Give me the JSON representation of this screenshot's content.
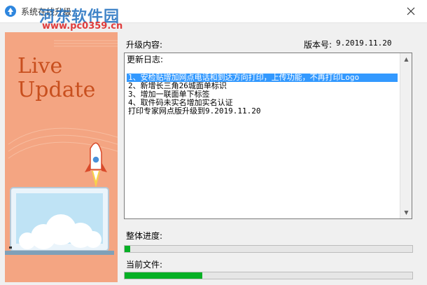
{
  "window": {
    "title": "系统在线升级",
    "watermark_site": "河东软件园",
    "watermark_url": "www.pc0359.cn"
  },
  "side_banner": {
    "line1": "Live",
    "line2": "Update",
    "bg_color": "#f4a582",
    "text_color": "#c84f1e"
  },
  "upgrade": {
    "content_label": "升级内容:",
    "version_label": "版本号:",
    "version_value": "9.2019.11.20"
  },
  "log": {
    "title": "更新日志:",
    "lines": [
      "1、安检贴增加网点电话和到达方向打印，上传功能，不再打印Logo",
      "2、新增长三角26城面单标识",
      "3、增加一联面单下标签",
      "4、取件码未实名增加实名认证",
      "打印专家网点版升级到9.2019.11.20"
    ],
    "selected_index": 0
  },
  "progress": {
    "overall_label": "整体进度:",
    "overall_fraction": 0.02,
    "current_label": "当前文件:",
    "current_fraction": 0.27
  },
  "colors": {
    "progress_fill": "#06b025",
    "selection": "#3399ff"
  }
}
